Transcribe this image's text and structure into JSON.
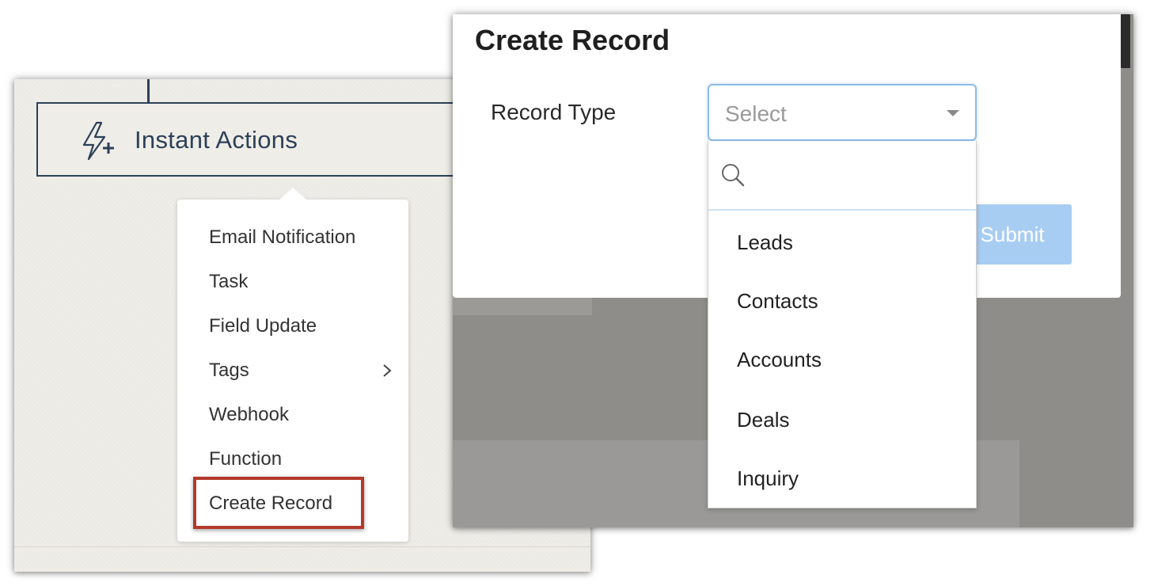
{
  "workflow": {
    "instant_actions_label": "Instant Actions",
    "menu_items": [
      {
        "label": "Email Notification"
      },
      {
        "label": "Task"
      },
      {
        "label": "Field Update"
      },
      {
        "label": "Tags",
        "has_submenu": true
      },
      {
        "label": "Webhook"
      },
      {
        "label": "Function"
      },
      {
        "label": "Create Record",
        "highlighted": true
      }
    ]
  },
  "modal": {
    "title": "Create Record",
    "record_type_label": "Record Type",
    "select_placeholder": "Select",
    "search_placeholder": "",
    "options": [
      "Leads",
      "Contacts",
      "Accounts",
      "Deals",
      "Inquiry"
    ],
    "submit_label": "Submit"
  },
  "colors": {
    "navy": "#2d4058",
    "highlight": "#b23a2b",
    "submit_bg": "#a8cdf2",
    "select_border": "#8dbbe8"
  },
  "icons": [
    "lightning-plus-icon",
    "chevron-right-icon",
    "dropdown-arrow-icon",
    "search-icon"
  ]
}
